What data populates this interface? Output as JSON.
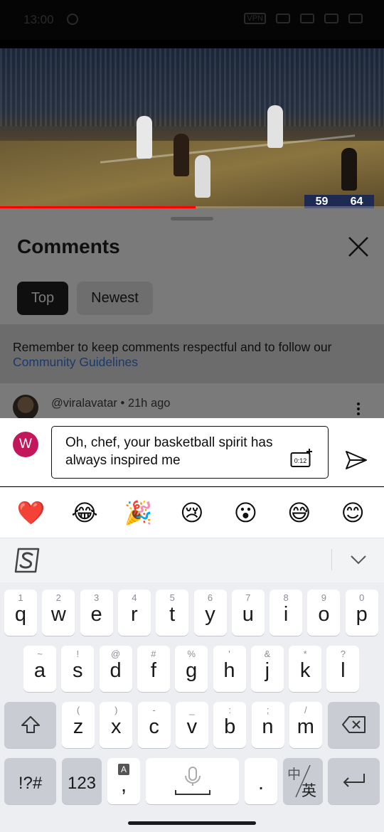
{
  "status_bar": {
    "time": "13:00",
    "vpn": "VPN"
  },
  "video": {
    "score_home": "59",
    "score_away": "64",
    "progress_fraction": 0.51
  },
  "comments": {
    "title": "Comments",
    "tabs": [
      {
        "label": "Top",
        "selected": true
      },
      {
        "label": "Newest",
        "selected": false
      }
    ],
    "notice_text": "Remember to keep comments respectful and to follow our",
    "notice_link": "Community Guidelines",
    "first_comment": {
      "author": "@viralavatar",
      "age": "• 21h ago"
    }
  },
  "composer": {
    "avatar_initial": "W",
    "avatar_color": "#c2185b",
    "text": "Oh, chef, your basketball spirit has always inspired me",
    "timestamp_icon_label": "0:12"
  },
  "emoji_bar": [
    "❤️",
    "😂",
    "🎉",
    "😢",
    "😮",
    "😅",
    "😊"
  ],
  "keyboard": {
    "row1": [
      [
        "q",
        "1"
      ],
      [
        "w",
        "2"
      ],
      [
        "e",
        "3"
      ],
      [
        "r",
        "4"
      ],
      [
        "t",
        "5"
      ],
      [
        "y",
        "6"
      ],
      [
        "u",
        "7"
      ],
      [
        "i",
        "8"
      ],
      [
        "o",
        "9"
      ],
      [
        "p",
        "0"
      ]
    ],
    "row2": [
      [
        "a",
        "~"
      ],
      [
        "s",
        "!"
      ],
      [
        "d",
        "@"
      ],
      [
        "f",
        "#"
      ],
      [
        "g",
        "%"
      ],
      [
        "h",
        "'"
      ],
      [
        "j",
        "&"
      ],
      [
        "k",
        "*"
      ],
      [
        "l",
        "?"
      ]
    ],
    "row3": [
      [
        "z",
        "("
      ],
      [
        "x",
        ")"
      ],
      [
        "c",
        "-"
      ],
      [
        "v",
        "_"
      ],
      [
        "b",
        ":"
      ],
      [
        "n",
        ";"
      ],
      [
        "m",
        "/"
      ]
    ],
    "symbols_label": "!?#",
    "numbers_label": "123",
    "comma_label": ",",
    "period_label": ".",
    "lang_top": "中",
    "lang_bottom": "英"
  }
}
